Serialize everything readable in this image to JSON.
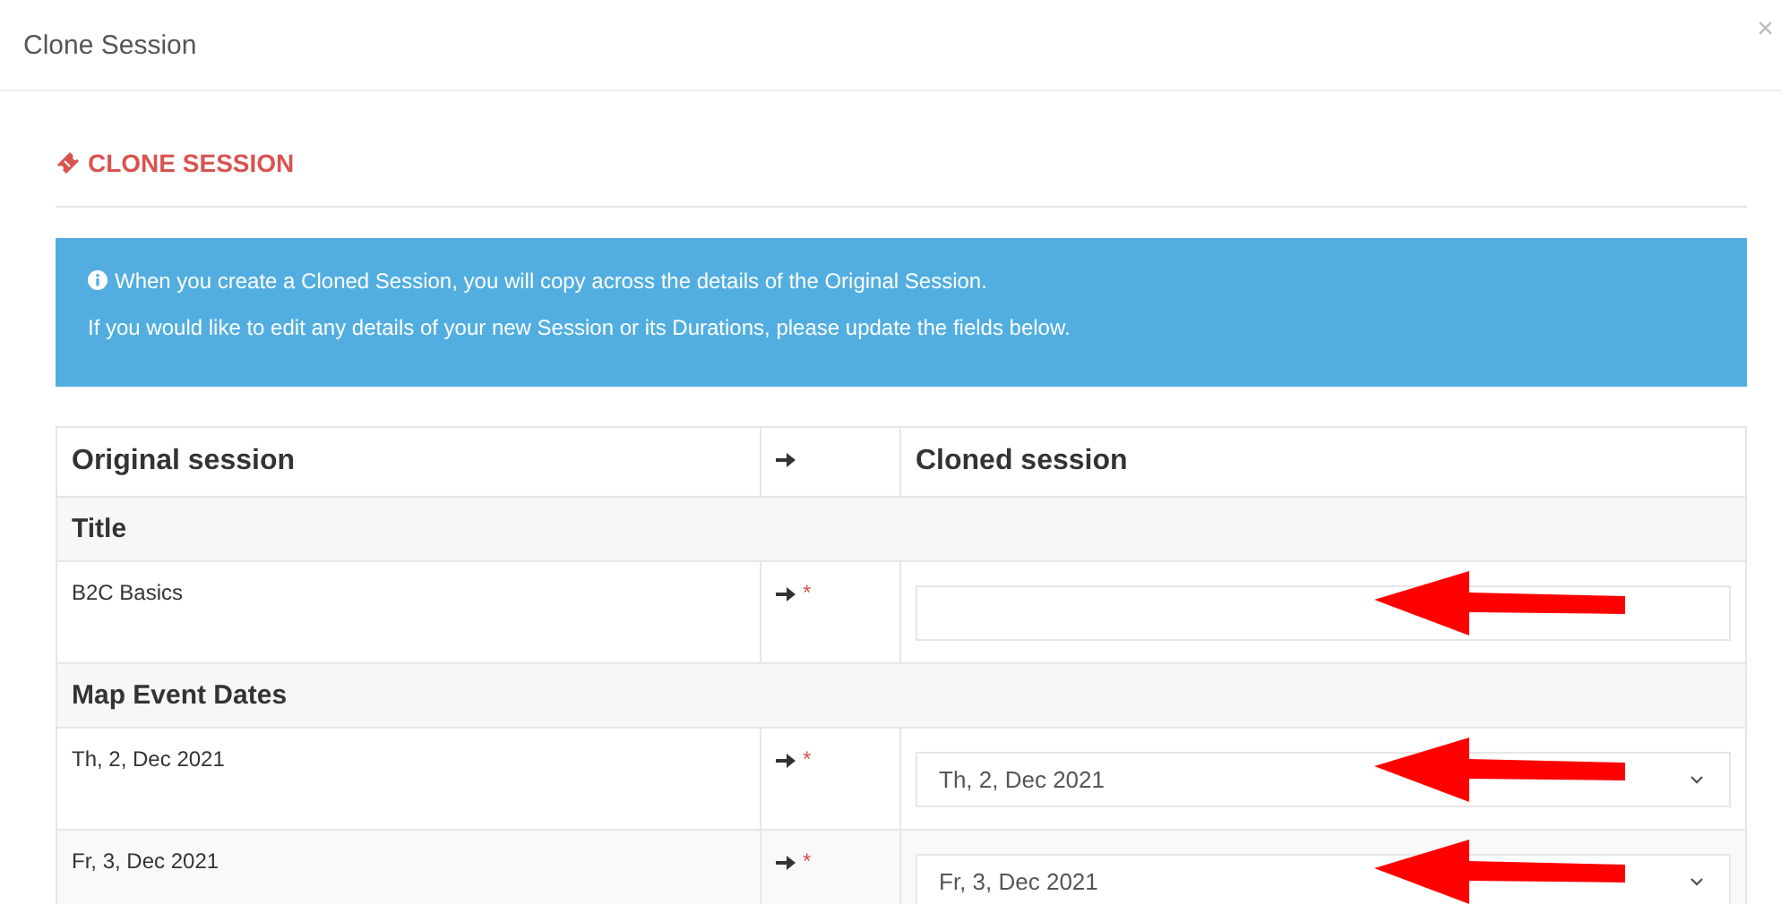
{
  "window": {
    "title": "Clone Session",
    "close": "×"
  },
  "section_heading": "CLONE SESSION",
  "info": {
    "lines": [
      "When you create a Cloned Session, you will copy across the details of the Original Session.",
      "If you would like to edit any details of your new Session or its Durations, please update the fields below."
    ]
  },
  "table": {
    "columns": [
      "Original session",
      "Cloned session"
    ],
    "rows": [
      {
        "kind": "section",
        "label": "Title"
      },
      {
        "kind": "text",
        "original": "B2C Basics",
        "required_mark": "*",
        "annotated": true
      },
      {
        "kind": "section",
        "label": "Map Event Dates"
      },
      {
        "kind": "select",
        "original": "Th, 2, Dec 2021",
        "required_mark": "*",
        "value": "Th, 2, Dec 2021",
        "annotated": true
      },
      {
        "kind": "select",
        "original": "Fr, 3, Dec 2021",
        "required_mark": "*",
        "value": "Fr, 3, Dec 2021",
        "annotated": true
      }
    ]
  }
}
